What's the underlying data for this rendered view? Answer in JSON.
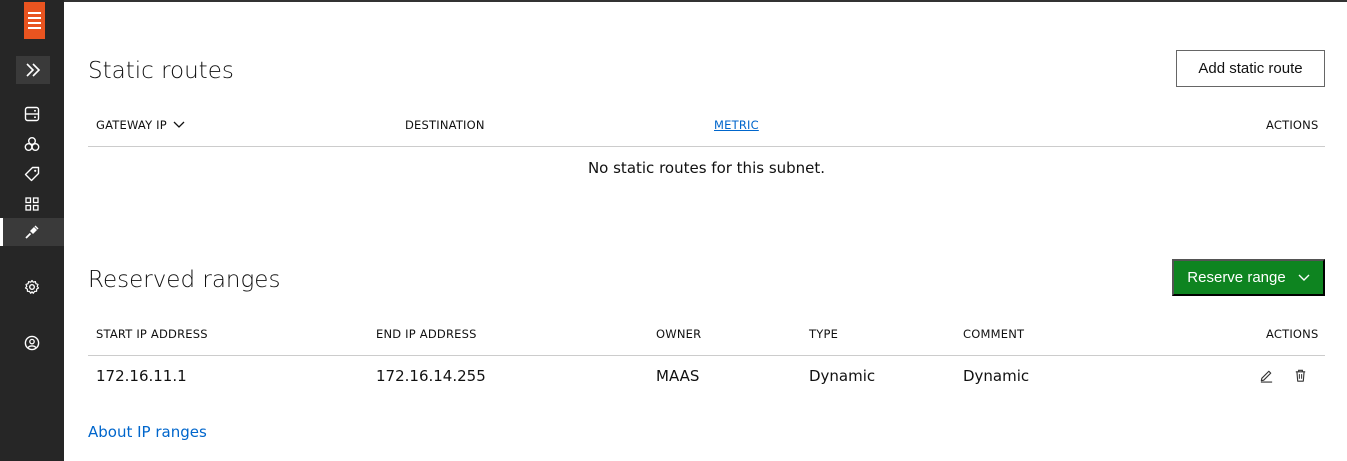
{
  "sidebar": {
    "logo": "maas-logo",
    "expand_icon": "double-chevron-right-icon",
    "items": [
      {
        "icon": "machines-icon"
      },
      {
        "icon": "pools-icon"
      },
      {
        "icon": "tags-icon"
      },
      {
        "icon": "zones-icon"
      },
      {
        "icon": "networking-icon",
        "active": true
      },
      {
        "icon": "settings-icon"
      },
      {
        "icon": "account-icon"
      }
    ]
  },
  "static_routes": {
    "title": "Static routes",
    "add_button": "Add static route",
    "columns": [
      "GATEWAY IP",
      "DESTINATION",
      "METRIC",
      "ACTIONS"
    ],
    "empty_message": "No static routes for this subnet."
  },
  "reserved_ranges": {
    "title": "Reserved ranges",
    "reserve_button": "Reserve range",
    "columns": [
      "START IP ADDRESS",
      "END IP ADDRESS",
      "OWNER",
      "TYPE",
      "COMMENT",
      "ACTIONS"
    ],
    "rows": [
      {
        "start": "172.16.11.1",
        "end": "172.16.14.255",
        "owner": "MAAS",
        "type": "Dynamic",
        "comment": "Dynamic"
      }
    ],
    "about_link": "About IP ranges"
  },
  "colors": {
    "sidebar": "#262626",
    "brand": "#e95420",
    "primary": "#0e8420",
    "link": "#0066cc"
  }
}
